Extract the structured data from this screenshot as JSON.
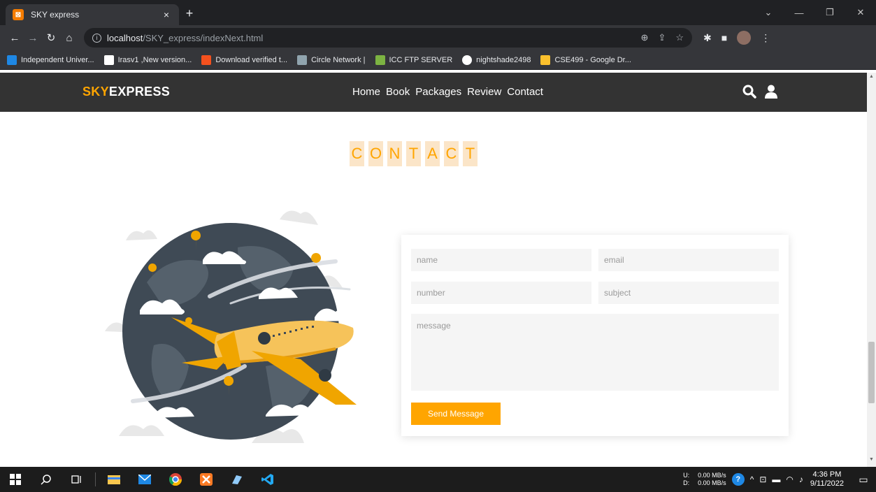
{
  "browser": {
    "tab_title": "SKY express",
    "tab_close": "×",
    "new_tab": "+",
    "url_host": "localhost",
    "url_path": "/SKY_express/indexNext.html",
    "bookmarks": [
      {
        "label": "Independent Univer...",
        "color": "#1e88e5"
      },
      {
        "label": "Irasv1 ,New version...",
        "color": "#ffffff"
      },
      {
        "label": "Download verified t...",
        "color": "#f4511e"
      },
      {
        "label": "Circle Network |",
        "color": "#90a4ae"
      },
      {
        "label": "ICC FTP SERVER",
        "color": "#7cb342"
      },
      {
        "label": "nightshade2498",
        "color": "#ffffff"
      },
      {
        "label": "CSE499 - Google Dr...",
        "color": "#fbc02d"
      }
    ]
  },
  "site": {
    "logo_accent": "SKY",
    "logo_rest": "EXPRESS",
    "nav": [
      "Home",
      "Book",
      "Packages",
      "Review",
      "Contact"
    ],
    "heading_letters": [
      "C",
      "O",
      "N",
      "T",
      "A",
      "C",
      "T"
    ]
  },
  "form": {
    "name_placeholder": "name",
    "email_placeholder": "email",
    "number_placeholder": "number",
    "subject_placeholder": "subject",
    "message_placeholder": "message",
    "submit_label": "Send Message"
  },
  "taskbar": {
    "net_up_label": "U:",
    "net_down_label": "D:",
    "net_up": "0.00 MB/s",
    "net_down": "0.00 MB/s",
    "time": "4:36 PM",
    "date": "9/11/2022"
  },
  "colors": {
    "accent": "#ffa500",
    "header_bg": "#333333",
    "heading_letter_bg": "#fbe5c8"
  }
}
